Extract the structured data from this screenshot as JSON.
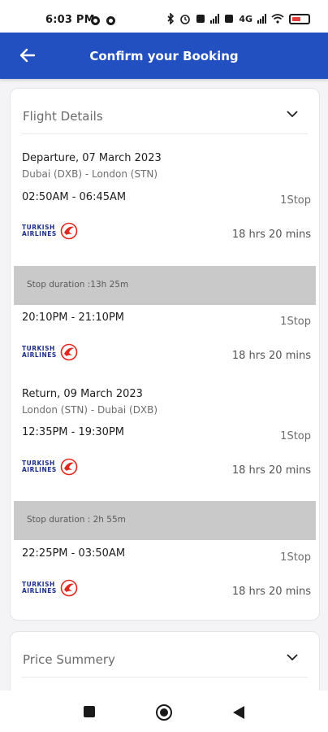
{
  "status": {
    "time": "6:03 PM",
    "network": "4G",
    "battery_icon": "battery-low-icon"
  },
  "appbar": {
    "title": "Confirm your Booking",
    "back_icon": "arrow-left-icon"
  },
  "flight_details": {
    "title": "Flight Details",
    "segments": [
      {
        "title": "Departure, 07 March 2023",
        "route": "Dubai (DXB) - London (STN)",
        "legs": [
          {
            "time": "02:50AM - 06:45AM",
            "stops": "1Stop",
            "airline": "TURKISH AIRLINES",
            "duration": "18 hrs 20 mins"
          },
          {
            "time": "20:10PM - 21:10PM",
            "stops": "1Stop",
            "airline": "TURKISH AIRLINES",
            "duration": "18 hrs 20 mins"
          }
        ],
        "stop_duration": "Stop duration :13h 25m"
      },
      {
        "title": "Return, 09 March 2023",
        "route": "London (STN) - Dubai (DXB)",
        "legs": [
          {
            "time": "12:35PM - 19:30PM",
            "stops": "1Stop",
            "airline": "TURKISH AIRLINES",
            "duration": "18 hrs 20 mins"
          },
          {
            "time": "22:25PM - 03:50AM",
            "stops": "1Stop",
            "airline": "TURKISH AIRLINES",
            "duration": "18 hrs 20 mins"
          }
        ],
        "stop_duration": "Stop duration : 2h 55m"
      }
    ]
  },
  "price_summary": {
    "title": "Price Summery"
  },
  "colors": {
    "primary": "#2250c0",
    "airline_red": "#e1261c",
    "airline_blue": "#1c2f8a"
  }
}
